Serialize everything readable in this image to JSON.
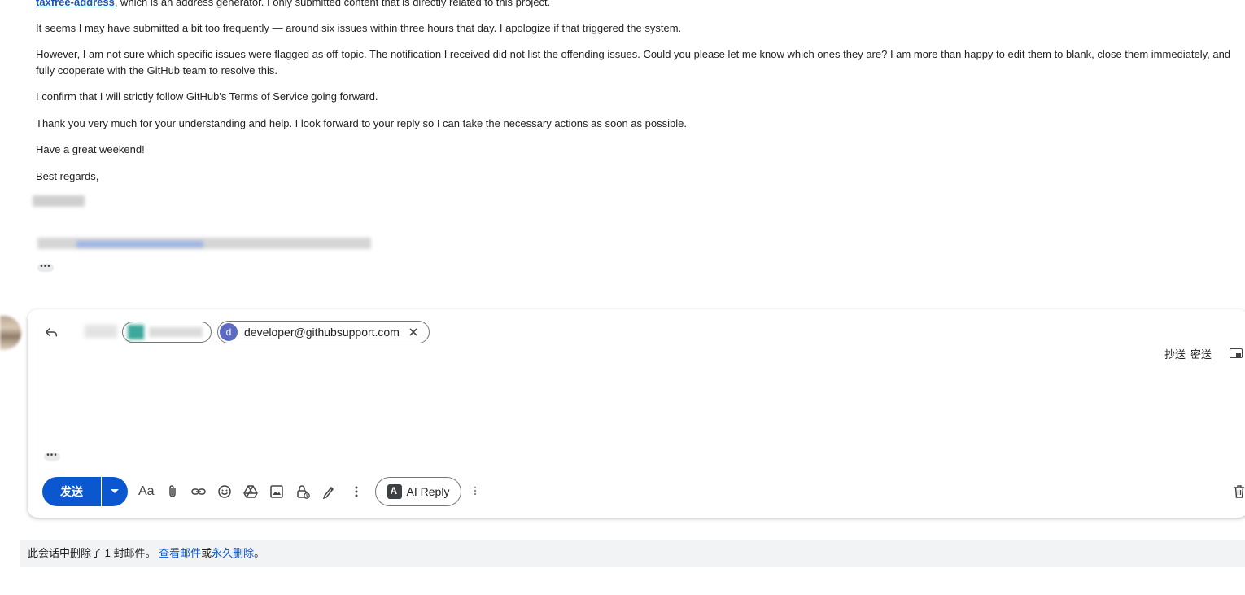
{
  "email": {
    "line0_link": "taxfree-address",
    "line0_rest": ", which is an address generator. I only submitted content that is directly related to this project.",
    "p1": "It seems I may have submitted a bit too frequently — around six issues within three hours that day. I apologize if that triggered the system.",
    "p2": "However, I am not sure which specific issues were flagged as off-topic. The notification I received did not list the offending issues. Could you please let me know which ones they are? I am more than happy to edit them to blank, close them immediately, and fully cooperate with the GitHub team to resolve this.",
    "p3": "I confirm that I will strictly follow GitHub's Terms of Service going forward.",
    "p4": "Thank you very much for your understanding and help. I look forward to your reply so I can take the necessary actions as soon as possible.",
    "p5": "Have a great weekend!",
    "p6": "Best regards,",
    "quoted_dots": "•••"
  },
  "compose": {
    "recipient_chip": {
      "avatar_letter": "d",
      "email": "developer@githubsupport.com"
    },
    "cc_label": "抄送",
    "bcc_label": "密送",
    "trimmed_dots": "•••",
    "send_label": "发送",
    "ai_reply_label": "AI Reply",
    "icons": [
      "reply-icon",
      "format-text-icon",
      "attach-icon",
      "link-icon",
      "emoji-icon",
      "drive-icon",
      "photo-icon",
      "confidential-icon",
      "signature-icon",
      "more-options-icon",
      "trash-icon",
      "popout-icon"
    ],
    "colors": {
      "primary": "#0b57d0",
      "chip_avatar": "#5c6bc0"
    }
  },
  "notice": {
    "text_before": "此会话中删除了 1 封邮件。 ",
    "view_link": "查看邮件",
    "or_text": "或",
    "delete_link": "永久删除",
    "end": "。"
  }
}
